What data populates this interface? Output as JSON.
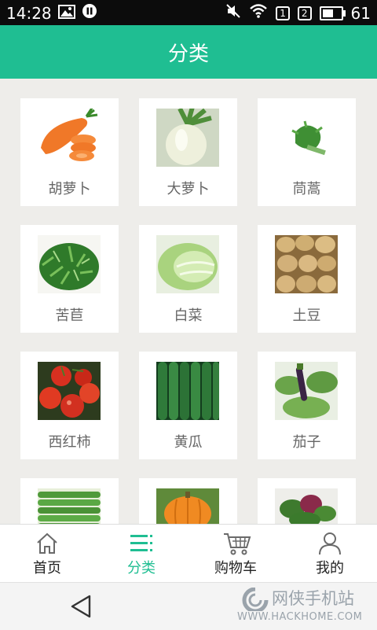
{
  "status": {
    "time": "14:28",
    "sim1": "1",
    "sim2": "2",
    "battery_text": "61",
    "battery_level": 0.61
  },
  "header": {
    "title": "分类"
  },
  "categories": [
    {
      "label": "胡萝卜",
      "icon": "carrot-image"
    },
    {
      "label": "大萝卜",
      "icon": "radish-image"
    },
    {
      "label": "茼蒿",
      "icon": "crown-daisy-image"
    },
    {
      "label": "苦苣",
      "icon": "endive-image"
    },
    {
      "label": "白菜",
      "icon": "cabbage-image"
    },
    {
      "label": "土豆",
      "icon": "potato-image"
    },
    {
      "label": "西红柿",
      "icon": "tomato-image"
    },
    {
      "label": "黄瓜",
      "icon": "cucumber-image"
    },
    {
      "label": "茄子",
      "icon": "eggplant-image"
    },
    {
      "label": "",
      "icon": "green-bean-image"
    },
    {
      "label": "",
      "icon": "pumpkin-image"
    },
    {
      "label": "",
      "icon": "amaranth-image"
    }
  ],
  "tabs": [
    {
      "label": "首页",
      "icon": "home-icon"
    },
    {
      "label": "分类",
      "icon": "category-list-icon",
      "active": true
    },
    {
      "label": "购物车",
      "icon": "cart-icon"
    },
    {
      "label": "我的",
      "icon": "user-icon"
    }
  ],
  "watermark": {
    "name": "网侠手机站",
    "url": "WWW.HACKHOME.COM"
  },
  "colors": {
    "accent": "#1fbe92",
    "background": "#eeedea"
  }
}
